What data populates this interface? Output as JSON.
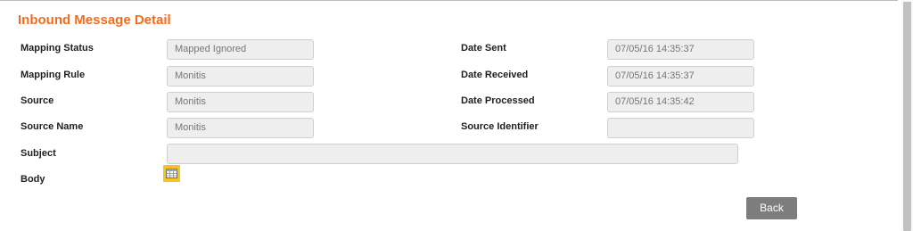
{
  "page": {
    "title": "Inbound Message Detail"
  },
  "fields": {
    "mapping_status": {
      "label": "Mapping Status",
      "value": "Mapped Ignored"
    },
    "mapping_rule": {
      "label": "Mapping Rule",
      "value": "Monitis"
    },
    "source": {
      "label": "Source",
      "value": "Monitis"
    },
    "source_name": {
      "label": "Source Name",
      "value": "Monitis"
    },
    "date_sent": {
      "label": "Date Sent",
      "value": "07/05/16 14:35:37"
    },
    "date_received": {
      "label": "Date Received",
      "value": "07/05/16 14:35:37"
    },
    "date_processed": {
      "label": "Date Processed",
      "value": "07/05/16 14:35:42"
    },
    "source_identifier": {
      "label": "Source Identifier",
      "value": ""
    },
    "subject": {
      "label": "Subject",
      "value": ""
    },
    "body": {
      "label": "Body",
      "icon": "table-icon"
    }
  },
  "actions": {
    "back_label": "Back"
  },
  "colors": {
    "title": "#f26c1f",
    "icon_highlight": "#f7c31c",
    "back_button": "#7d7d7d"
  }
}
